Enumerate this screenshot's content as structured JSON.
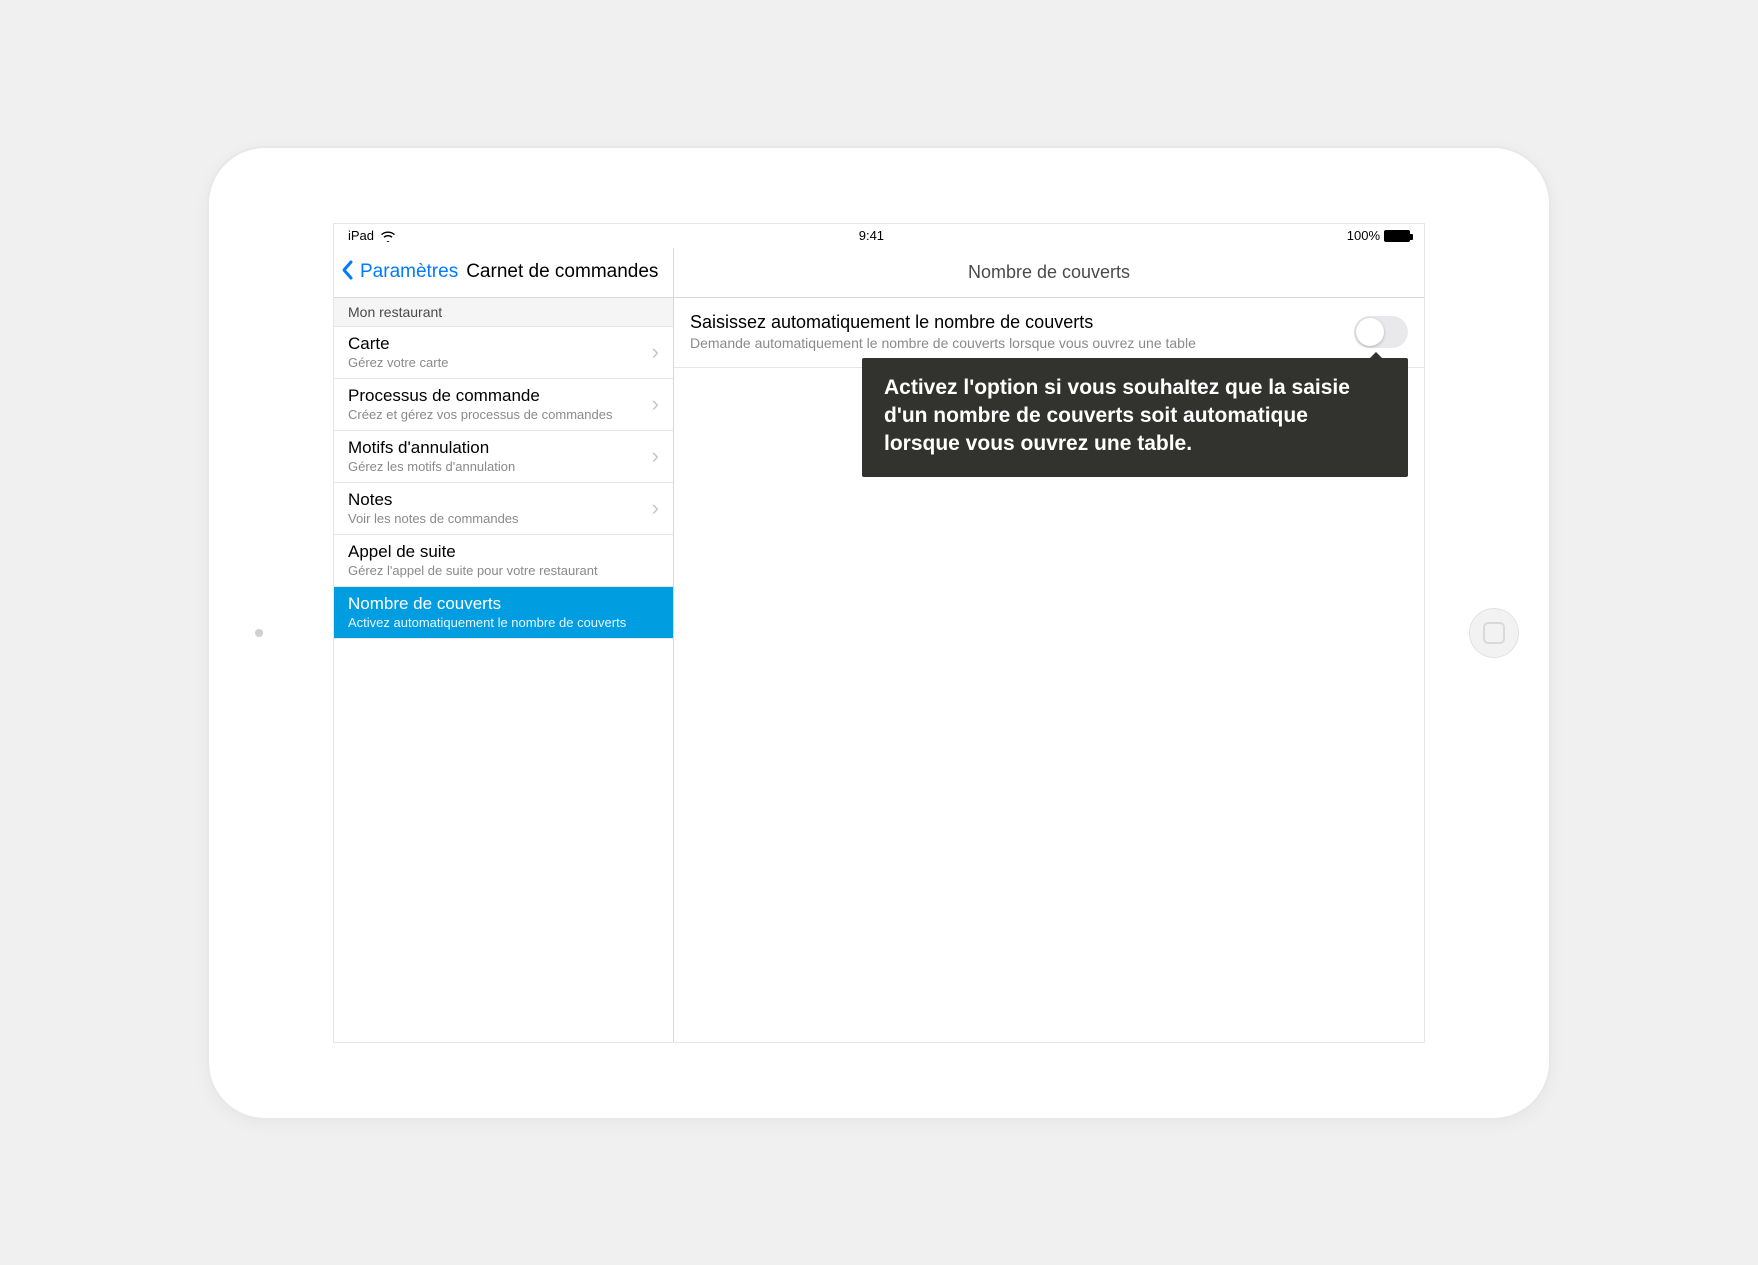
{
  "status": {
    "device": "iPad",
    "time": "9:41",
    "battery": "100%"
  },
  "nav": {
    "back_label": "Paramètres",
    "left_title": "Carnet de commandes",
    "right_title": "Nombre de couverts"
  },
  "sidebar": {
    "section_header": "Mon restaurant",
    "items": [
      {
        "title": "Carte",
        "subtitle": "Gérez votre carte",
        "chevron": true
      },
      {
        "title": "Processus de commande",
        "subtitle": "Créez et gérez vos processus de commandes",
        "chevron": true
      },
      {
        "title": "Motifs d'annulation",
        "subtitle": "Gérez les motifs d'annulation",
        "chevron": true
      },
      {
        "title": "Notes",
        "subtitle": "Voir les notes de commandes",
        "chevron": true
      },
      {
        "title": "Appel de suite",
        "subtitle": "Gérez l'appel de suite pour votre restaurant",
        "chevron": false
      },
      {
        "title": "Nombre de couverts",
        "subtitle": "Activez automatiquement le nombre de couverts",
        "chevron": false,
        "selected": true
      }
    ]
  },
  "detail": {
    "setting_title": "Saisissez automatiquement le nombre de couverts",
    "setting_subtitle": "Demande automatiquement le nombre de couverts lorsque vous ouvrez une table",
    "toggle_on": false
  },
  "tooltip": {
    "text": "Activez l'option si vous souhaItez que la saisie d'un nombre de couverts soit automatique lorsque vous ouvrez une table."
  }
}
